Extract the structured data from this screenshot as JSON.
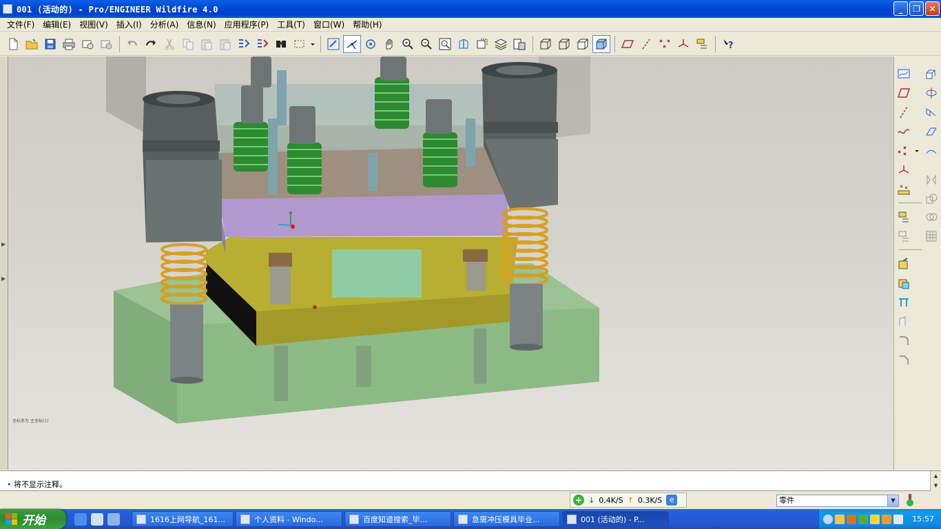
{
  "window": {
    "title": "001 (活动的) - Pro/ENGINEER Wildfire 4.0",
    "buttons": {
      "minimize": "_",
      "maximize": "❐",
      "close": "✕"
    }
  },
  "menubar": {
    "items": [
      "文件(F)",
      "编辑(E)",
      "视图(V)",
      "插入(I)",
      "分析(A)",
      "信息(N)",
      "应用程序(P)",
      "工具(T)",
      "窗口(W)",
      "帮助(H)"
    ]
  },
  "graphics": {
    "coord_label": "坐标系为 主坐标(1)"
  },
  "message": {
    "bullet": "•",
    "text": "将不显示注释。"
  },
  "status": {
    "download_speed": "0.4K/S",
    "upload_speed": "0.3K/S",
    "filter_value": "零件"
  },
  "taskbar": {
    "start_label": "开始",
    "tasks": [
      "1616上网导航_161...",
      "个人资料 - Windo...",
      "百度知道搜索_毕...",
      "急需冲压模具毕业...",
      "001 (活动的) - P..."
    ],
    "clock": "15:57"
  },
  "colors": {
    "title_bar": "#0449d6",
    "taskbar": "#245edb",
    "start_button": "#2f8a2f",
    "viewport_bg": "#d4d2cb"
  }
}
